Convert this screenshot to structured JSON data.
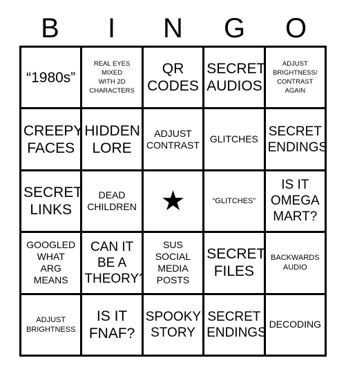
{
  "card": {
    "title": "BINGO",
    "header_letters": [
      "B",
      "I",
      "N",
      "G",
      "O"
    ],
    "free_space": {
      "icon": "star-icon",
      "glyph": "★",
      "row": 3,
      "column": 3
    },
    "colors": {
      "background": "#ffffff",
      "text": "#000000",
      "border": "#000000"
    },
    "rows": [
      [
        {
          "text": "“1980s”",
          "size": "xl"
        },
        {
          "text": "REAL EYES\nMIXED\nWITH 2D\nCHARACTERS",
          "size": "xs"
        },
        {
          "text": "QR\nCODES",
          "size": "xl"
        },
        {
          "text": "SECRET\nAUDIOS",
          "size": "xl"
        },
        {
          "text": "ADJUST\nBRIGHTNESS/\nCONTRAST\nAGAIN",
          "size": "xs"
        }
      ],
      [
        {
          "text": "CREEPY\nFACES",
          "size": "xl"
        },
        {
          "text": "HIDDEN\nLORE",
          "size": "xl"
        },
        {
          "text": "ADJUST\nCONTRAST",
          "size": "md"
        },
        {
          "text": "GLITCHES",
          "size": "md"
        },
        {
          "text": "SECRET\nENDINGS",
          "size": "lg"
        }
      ],
      [
        {
          "text": "SECRET\nLINKS",
          "size": "xl"
        },
        {
          "text": "DEAD\nCHILDREN",
          "size": "md"
        },
        {
          "text": "★",
          "size": "free"
        },
        {
          "text": "“GLITCHES”",
          "size": "sm"
        },
        {
          "text": "IS IT\nOMEGA\nMART?",
          "size": "lg"
        }
      ],
      [
        {
          "text": "GOOGLED\nWHAT\nARG\nMEANS",
          "size": "md"
        },
        {
          "text": "CAN IT\nBE A\nTHEORY?",
          "size": "lg"
        },
        {
          "text": "SUS\nSOCIAL\nMEDIA\nPOSTS",
          "size": "md"
        },
        {
          "text": "SECRET\nFILES",
          "size": "xl"
        },
        {
          "text": "BACKWARDS\nAUDIO",
          "size": "sm"
        }
      ],
      [
        {
          "text": "ADJUST\nBRIGHTNESS",
          "size": "sm"
        },
        {
          "text": "IS IT\nFNAF?",
          "size": "xl"
        },
        {
          "text": "SPOOKY\nSTORY",
          "size": "lg"
        },
        {
          "text": "SECRET\nENDINGS",
          "size": "lg"
        },
        {
          "text": "DECODING",
          "size": "md"
        }
      ]
    ]
  }
}
